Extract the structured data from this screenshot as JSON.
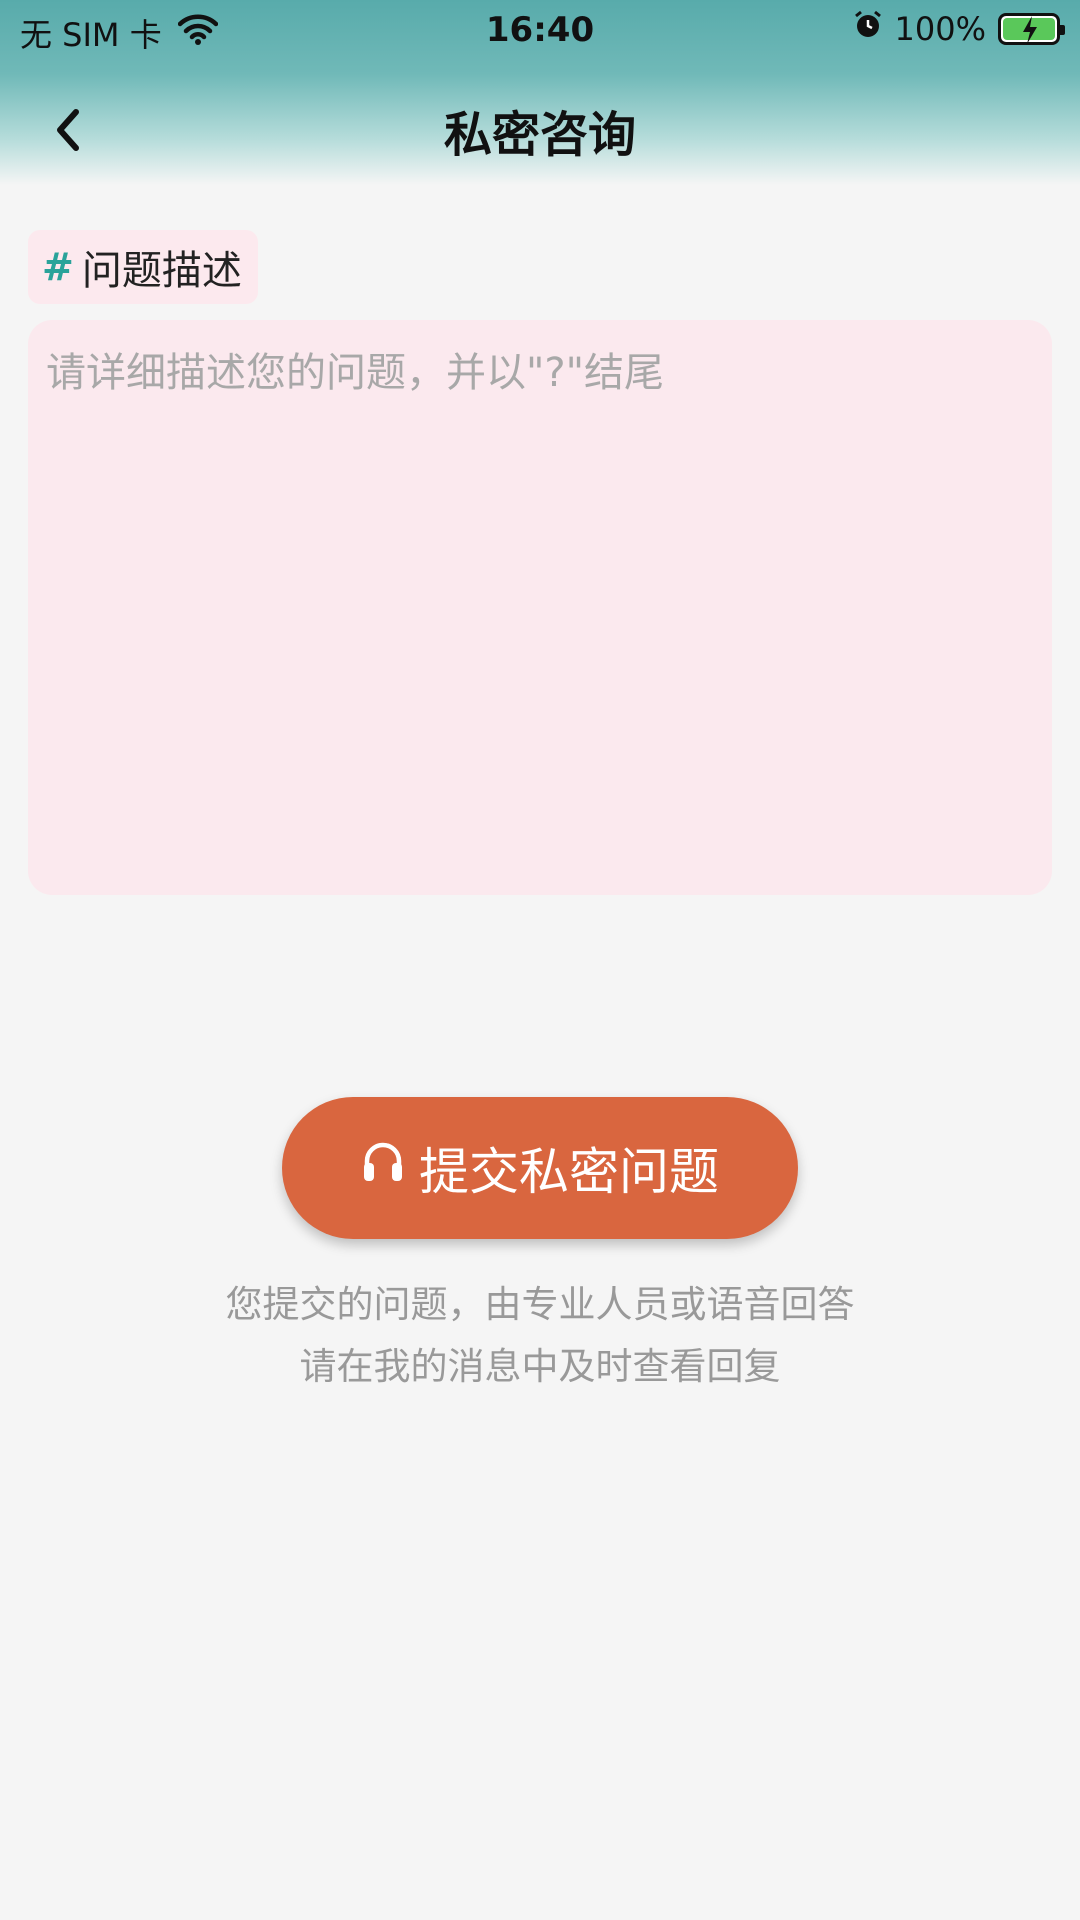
{
  "status_bar": {
    "carrier": "无 SIM 卡",
    "time": "16:40",
    "battery": "100%",
    "icons": [
      "wifi-icon",
      "alarm-icon",
      "battery-charging-icon"
    ]
  },
  "nav": {
    "title": "私密咨询",
    "back_icon": "chevron-left-icon"
  },
  "form": {
    "section_tag_symbol": "#",
    "section_tag_label": "问题描述",
    "placeholder": "请详细描述您的问题，并以\"?\"结尾",
    "value": ""
  },
  "submit": {
    "icon": "headset-icon",
    "label": "提交私密问题"
  },
  "hints": {
    "line1": "您提交的问题，由专业人员或语音回答",
    "line2": "请在我的消息中及时查看回复"
  },
  "colors": {
    "header_teal": "#58abab",
    "accent_hash": "#2aa39a",
    "input_bg": "#fbe9ee",
    "button": "#d9663f",
    "page_bg": "#f5f5f5"
  }
}
